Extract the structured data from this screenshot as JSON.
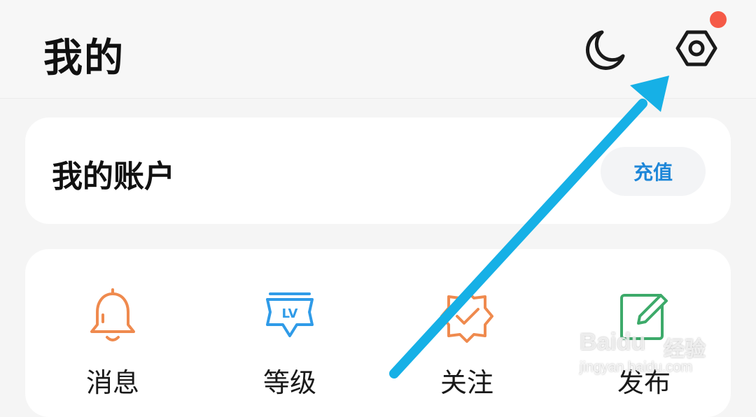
{
  "header": {
    "title": "我的",
    "night_mode_icon": "moon-icon",
    "settings_icon": "hexagon-gear-icon",
    "settings_badge_color": "#f55a47"
  },
  "account": {
    "title": "我的账户",
    "recharge_label": "充值",
    "recharge_color": "#1d86d8"
  },
  "quick_actions": [
    {
      "label": "消息",
      "icon": "bell-icon",
      "color": "#ef8a4e"
    },
    {
      "label": "等级",
      "icon": "level-badge-icon",
      "icon_text": "LV",
      "color": "#2f9be8"
    },
    {
      "label": "关注",
      "icon": "verified-badge-icon",
      "color": "#ef8a4e"
    },
    {
      "label": "发布",
      "icon": "edit-note-icon",
      "color": "#3daa6a"
    }
  ],
  "annotation": {
    "arrow_color": "#16b0e6"
  },
  "watermark": {
    "brand": "Baidu",
    "cn": "经验",
    "url": "jingyan.baidu.com"
  }
}
